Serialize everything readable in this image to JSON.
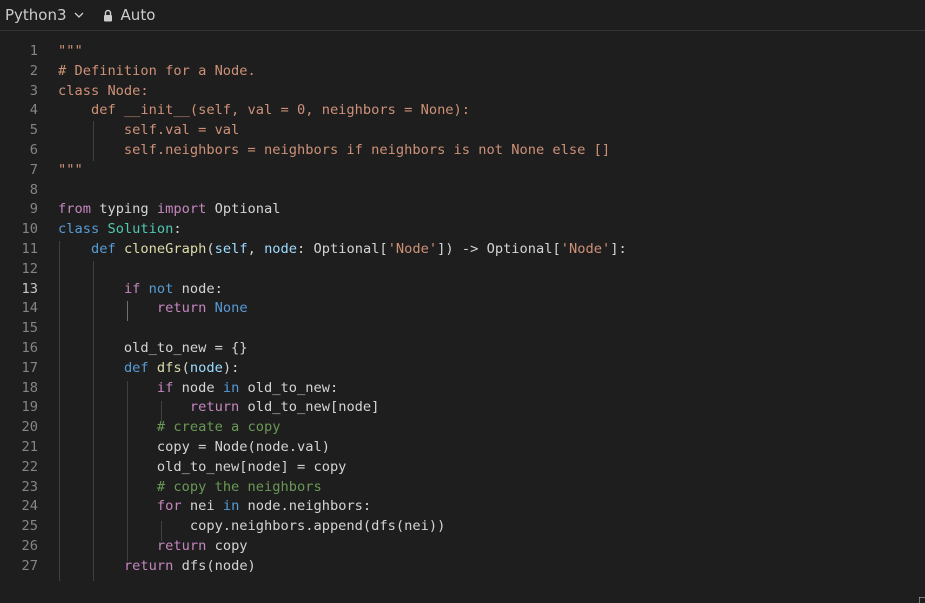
{
  "toolbar": {
    "language": "Python3",
    "language_icon": "chevron-down-icon",
    "mode_icon": "lock-icon",
    "mode": "Auto"
  },
  "colors": {
    "background": "#1e1e1e",
    "string": "#ce9178",
    "keyword": "#569cd6",
    "control_keyword": "#c586c0",
    "class_name": "#4ec9b0",
    "function_name": "#dcdcaa",
    "parameter": "#9cdcfe",
    "comment": "#6a9955",
    "text": "#d4d4d4"
  },
  "editor": {
    "active_line": 13,
    "lines": [
      {
        "n": "1",
        "tokens": [
          [
            "str",
            "\"\"\""
          ]
        ]
      },
      {
        "n": "2",
        "tokens": [
          [
            "str",
            "# Definition for a Node."
          ]
        ]
      },
      {
        "n": "3",
        "tokens": [
          [
            "str",
            "class Node:"
          ]
        ]
      },
      {
        "n": "4",
        "tokens": [
          [
            "str",
            "    def __init__(self, val = 0, neighbors = None):"
          ]
        ]
      },
      {
        "n": "5",
        "tokens": [
          [
            "str",
            "        self.val = val"
          ]
        ]
      },
      {
        "n": "6",
        "tokens": [
          [
            "str",
            "        self.neighbors = neighbors if neighbors is not None else []"
          ]
        ]
      },
      {
        "n": "7",
        "tokens": [
          [
            "str",
            "\"\"\""
          ]
        ]
      },
      {
        "n": "8",
        "tokens": []
      },
      {
        "n": "9",
        "tokens": [
          [
            "kw2",
            "from"
          ],
          [
            "txt",
            " typing "
          ],
          [
            "kw2",
            "import"
          ],
          [
            "txt",
            " Optional"
          ]
        ]
      },
      {
        "n": "10",
        "tokens": [
          [
            "kw",
            "class"
          ],
          [
            "txt",
            " "
          ],
          [
            "cls",
            "Solution"
          ],
          [
            "txt",
            ":"
          ]
        ]
      },
      {
        "n": "11",
        "tokens": [
          [
            "txt",
            "    "
          ],
          [
            "kw",
            "def"
          ],
          [
            "txt",
            " "
          ],
          [
            "fn",
            "cloneGraph"
          ],
          [
            "txt",
            "("
          ],
          [
            "prm",
            "self"
          ],
          [
            "txt",
            ", "
          ],
          [
            "prm",
            "node"
          ],
          [
            "txt",
            ": Optional["
          ],
          [
            "str",
            "'Node'"
          ],
          [
            "txt",
            "]) -> Optional["
          ],
          [
            "str",
            "'Node'"
          ],
          [
            "txt",
            "]:"
          ]
        ]
      },
      {
        "n": "12",
        "tokens": []
      },
      {
        "n": "13",
        "tokens": [
          [
            "txt",
            "        "
          ],
          [
            "kw2",
            "if"
          ],
          [
            "txt",
            " "
          ],
          [
            "kw",
            "not"
          ],
          [
            "txt",
            " node:"
          ]
        ]
      },
      {
        "n": "14",
        "tokens": [
          [
            "txt",
            "            "
          ],
          [
            "kw2",
            "return"
          ],
          [
            "txt",
            " "
          ],
          [
            "kw",
            "None"
          ]
        ]
      },
      {
        "n": "15",
        "tokens": []
      },
      {
        "n": "16",
        "tokens": [
          [
            "txt",
            "        old_to_new = {}"
          ]
        ]
      },
      {
        "n": "17",
        "tokens": [
          [
            "txt",
            "        "
          ],
          [
            "kw",
            "def"
          ],
          [
            "txt",
            " "
          ],
          [
            "fn",
            "dfs"
          ],
          [
            "txt",
            "("
          ],
          [
            "prm",
            "node"
          ],
          [
            "txt",
            "):"
          ]
        ]
      },
      {
        "n": "18",
        "tokens": [
          [
            "txt",
            "            "
          ],
          [
            "kw2",
            "if"
          ],
          [
            "txt",
            " node "
          ],
          [
            "kw",
            "in"
          ],
          [
            "txt",
            " old_to_new:"
          ]
        ]
      },
      {
        "n": "19",
        "tokens": [
          [
            "txt",
            "                "
          ],
          [
            "kw2",
            "return"
          ],
          [
            "txt",
            " old_to_new[node]"
          ]
        ]
      },
      {
        "n": "20",
        "tokens": [
          [
            "txt",
            "            "
          ],
          [
            "com",
            "# create a copy"
          ]
        ]
      },
      {
        "n": "21",
        "tokens": [
          [
            "txt",
            "            copy = Node(node.val)"
          ]
        ]
      },
      {
        "n": "22",
        "tokens": [
          [
            "txt",
            "            old_to_new[node] = copy"
          ]
        ]
      },
      {
        "n": "23",
        "tokens": [
          [
            "txt",
            "            "
          ],
          [
            "com",
            "# copy the neighbors"
          ]
        ]
      },
      {
        "n": "24",
        "tokens": [
          [
            "txt",
            "            "
          ],
          [
            "kw2",
            "for"
          ],
          [
            "txt",
            " nei "
          ],
          [
            "kw",
            "in"
          ],
          [
            "txt",
            " node.neighbors:"
          ]
        ]
      },
      {
        "n": "25",
        "tokens": [
          [
            "txt",
            "                copy.neighbors.append(dfs(nei))"
          ]
        ]
      },
      {
        "n": "26",
        "tokens": [
          [
            "txt",
            "            "
          ],
          [
            "kw2",
            "return"
          ],
          [
            "txt",
            " copy"
          ]
        ]
      },
      {
        "n": "27",
        "tokens": [
          [
            "txt",
            "        "
          ],
          [
            "kw2",
            "return"
          ],
          [
            "txt",
            " dfs(node)"
          ]
        ]
      }
    ]
  }
}
